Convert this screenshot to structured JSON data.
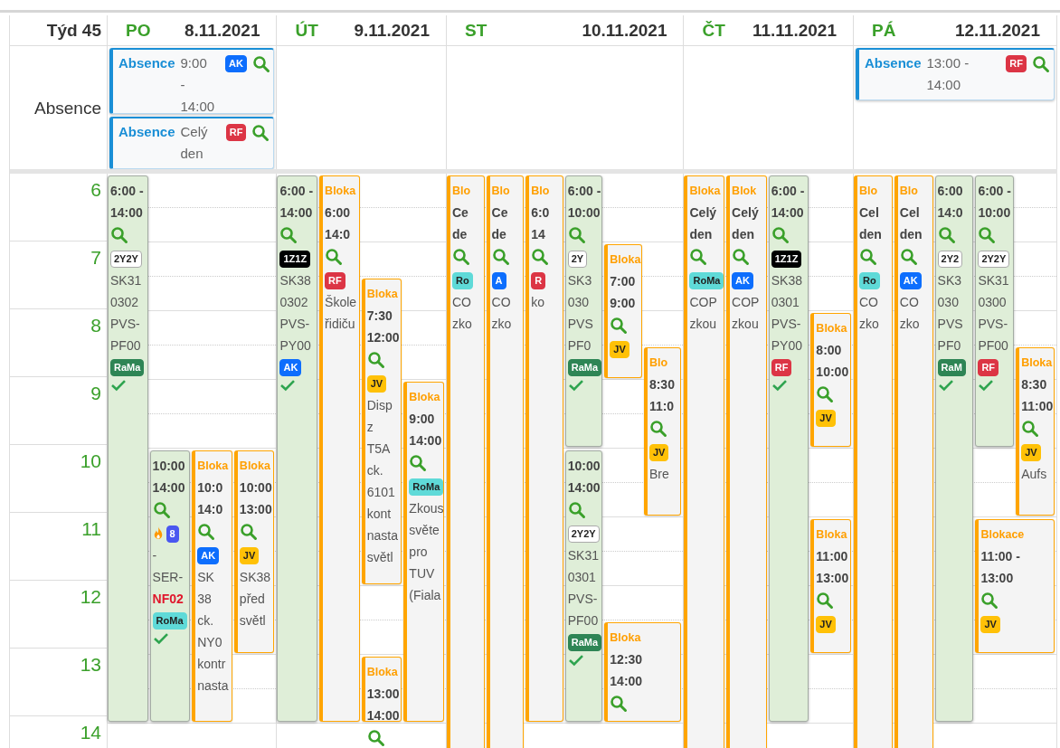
{
  "header": {
    "week": "Týd 45"
  },
  "absence_label": "Absence",
  "hours": [
    "6",
    "7",
    "8",
    "9",
    "10",
    "11",
    "12",
    "13",
    "14"
  ],
  "days": [
    {
      "name": "PO",
      "date": "8.11.2021",
      "absences": [
        {
          "label": "Absence",
          "time": "9:00 - 14:00",
          "badge": {
            "text": "AK",
            "color": "#0d6efd"
          }
        },
        {
          "label": "Absence",
          "time": "Celý den",
          "badge": {
            "text": "RF",
            "color": "#dc3545"
          }
        }
      ],
      "events": [
        {
          "kind": "job",
          "all_day": false,
          "time": [
            "6:00 -",
            "14:00"
          ],
          "top_badges": [
            {
              "text": "2Y2Y",
              "color": "#ffffff"
            }
          ],
          "fire": false,
          "desc": [
            "SK31",
            "0302",
            "PVS-",
            "PF00"
          ],
          "bottom_badges": [
            {
              "text": "RaMa",
              "color": "#2e8555"
            }
          ],
          "confirmed": true
        },
        {
          "kind": "job",
          "all_day": false,
          "time": [
            "10:00",
            "14:00"
          ],
          "top_badges": [
            {
              "text": "8",
              "color": "#4a57f0"
            }
          ],
          "fire": true,
          "desc": [
            "-",
            "SER-"
          ],
          "flagged": "NF02",
          "bottom_badges": [
            {
              "text": "RoMa",
              "color": "#5fdad8"
            }
          ],
          "confirmed": true
        },
        {
          "kind": "block",
          "all_day": false,
          "title": "Bloka",
          "time": [
            "10:0",
            "14:0"
          ],
          "top_badges": [
            {
              "text": "AK",
              "color": "#0d6efd"
            }
          ],
          "fire": false,
          "desc": [
            "SK",
            "38",
            "ck.",
            "NY0",
            "kontr",
            "nasta"
          ],
          "confirmed": false
        },
        {
          "kind": "block",
          "all_day": false,
          "title": "Bloka",
          "time": [
            "10:00",
            "13:00"
          ],
          "top_badges": [
            {
              "text": "JV",
              "color": "#ffc107"
            }
          ],
          "fire": false,
          "desc": [
            "SK38",
            "před",
            "světl"
          ],
          "confirmed": false
        }
      ]
    },
    {
      "name": "ÚT",
      "date": "9.11.2021",
      "events": [
        {
          "kind": "job",
          "all_day": false,
          "time": [
            "6:00 -",
            "14:00"
          ],
          "top_badges": [
            {
              "text": "1Z1Z",
              "color": "#000000"
            }
          ],
          "fire": false,
          "desc": [
            "SK38",
            "0302",
            "PVS-",
            "PY00"
          ],
          "bottom_badges": [
            {
              "text": "AK",
              "color": "#0d6efd"
            }
          ],
          "confirmed": true
        },
        {
          "kind": "block",
          "all_day": false,
          "title": "Bloka",
          "time": [
            "6:00",
            "14:0"
          ],
          "top_badges": [
            {
              "text": "RF",
              "color": "#dc3545"
            }
          ],
          "fire": false,
          "desc": [
            "Škole",
            "řidiču"
          ],
          "confirmed": false
        },
        {
          "kind": "block",
          "all_day": false,
          "title": "Bloka",
          "time": [
            "7:30",
            "12:00"
          ],
          "top_badges": [
            {
              "text": "JV",
              "color": "#ffc107"
            }
          ],
          "fire": false,
          "desc": [
            "Disp",
            "z",
            "T5A",
            "ck.",
            "6101",
            "kont",
            "nasta",
            "světl"
          ],
          "confirmed": false
        },
        {
          "kind": "block",
          "all_day": false,
          "title": "Bloka",
          "time": [
            "9:00",
            "14:00"
          ],
          "top_badges": [
            {
              "text": "RoMa",
              "color": "#5fdad8"
            }
          ],
          "fire": false,
          "desc": [
            "Zkous",
            "světe",
            "pro",
            "TUV",
            "(Fiala"
          ],
          "confirmed": false
        },
        {
          "kind": "block",
          "all_day": false,
          "title": "Bloka",
          "time": [
            "13:00",
            "14:00"
          ],
          "fire": false,
          "confirmed": false
        }
      ]
    },
    {
      "name": "ST",
      "date": "10.11.2021",
      "events": [
        {
          "kind": "block",
          "all_day": true,
          "title": "Blo",
          "time": [
            "Ce",
            "de"
          ],
          "top_badges": [
            {
              "text": "Ro",
              "color": "#5fdad8"
            }
          ],
          "fire": false,
          "desc": [
            "CO",
            "zko"
          ],
          "confirmed": false
        },
        {
          "kind": "block",
          "all_day": true,
          "title": "Blo",
          "time": [
            "Ce",
            "de"
          ],
          "top_badges": [
            {
              "text": "A",
              "color": "#0d6efd"
            }
          ],
          "fire": false,
          "desc": [
            "CO",
            "zko"
          ],
          "confirmed": false
        },
        {
          "kind": "block",
          "all_day": false,
          "title": "Blo",
          "time": [
            "6:0",
            "14"
          ],
          "top_badges": [
            {
              "text": "R",
              "color": "#dc3545"
            }
          ],
          "fire": false,
          "desc": [
            "ko"
          ],
          "confirmed": false
        },
        {
          "kind": "job",
          "all_day": false,
          "time": [
            "6:00 -",
            "10:00"
          ],
          "top_badges": [
            {
              "text": "2Y",
              "color": "#ffffff"
            }
          ],
          "fire": false,
          "desc": [
            "SK3",
            "030",
            "PVS",
            "PF0"
          ],
          "bottom_badges": [
            {
              "text": "RaMa",
              "color": "#2e8555"
            }
          ],
          "confirmed": true
        },
        {
          "kind": "block",
          "all_day": false,
          "title": "Bloka",
          "time": [
            "7:00",
            "9:00"
          ],
          "top_badges": [
            {
              "text": "JV",
              "color": "#ffc107"
            }
          ],
          "fire": false,
          "confirmed": false
        },
        {
          "kind": "block",
          "all_day": false,
          "title": "Blo",
          "time": [
            "8:30",
            "11:0"
          ],
          "top_badges": [
            {
              "text": "JV",
              "color": "#ffc107"
            }
          ],
          "fire": false,
          "desc": [
            "Bre"
          ],
          "confirmed": false
        },
        {
          "kind": "job",
          "all_day": false,
          "time": [
            "10:00",
            "14:00"
          ],
          "top_badges": [
            {
              "text": "2Y2Y",
              "color": "#ffffff"
            }
          ],
          "fire": false,
          "desc": [
            "SK31",
            "0301",
            "PVS-",
            "PF00"
          ],
          "bottom_badges": [
            {
              "text": "RaMa",
              "color": "#2e8555"
            }
          ],
          "confirmed": true
        },
        {
          "kind": "block",
          "all_day": false,
          "title": "Bloka",
          "time": [
            "12:30",
            "14:00"
          ],
          "fire": false,
          "confirmed": false
        }
      ]
    },
    {
      "name": "ČT",
      "date": "11.11.2021",
      "events": [
        {
          "kind": "block",
          "all_day": true,
          "title": "Bloka",
          "time": [
            "Celý",
            "den"
          ],
          "top_badges": [
            {
              "text": "RoMa",
              "color": "#5fdad8"
            }
          ],
          "fire": false,
          "desc": [
            "COP",
            "zkou"
          ],
          "confirmed": false
        },
        {
          "kind": "block",
          "all_day": true,
          "title": "Blok",
          "time": [
            "Celý",
            "den"
          ],
          "top_badges": [
            {
              "text": "AK",
              "color": "#0d6efd"
            }
          ],
          "fire": false,
          "desc": [
            "COP",
            "zkou"
          ],
          "confirmed": false
        },
        {
          "kind": "job",
          "all_day": false,
          "time": [
            "6:00 -",
            "14:00"
          ],
          "top_badges": [
            {
              "text": "1Z1Z",
              "color": "#000000"
            }
          ],
          "fire": false,
          "desc": [
            "SK38",
            "0301",
            "PVS-",
            "PY00"
          ],
          "bottom_badges": [
            {
              "text": "RF",
              "color": "#dc3545"
            }
          ],
          "confirmed": true
        },
        {
          "kind": "block",
          "all_day": false,
          "title": "Bloka",
          "time": [
            "8:00",
            "10:00"
          ],
          "top_badges": [
            {
              "text": "JV",
              "color": "#ffc107"
            }
          ],
          "fire": false,
          "confirmed": false
        },
        {
          "kind": "block",
          "all_day": false,
          "title": "Bloka",
          "time": [
            "11:00",
            "13:00"
          ],
          "top_badges": [
            {
              "text": "JV",
              "color": "#ffc107"
            }
          ],
          "fire": false,
          "confirmed": false
        }
      ]
    },
    {
      "name": "PÁ",
      "date": "12.11.2021",
      "absences": [
        {
          "label": "Absence",
          "time": "13:00 - 14:00",
          "badge": {
            "text": "RF",
            "color": "#dc3545"
          }
        }
      ],
      "events": [
        {
          "kind": "block",
          "all_day": true,
          "title": "Blo",
          "time": [
            "Cel",
            "den"
          ],
          "top_badges": [
            {
              "text": "Ro",
              "color": "#5fdad8"
            }
          ],
          "fire": false,
          "desc": [
            "CO",
            "zko"
          ],
          "confirmed": false
        },
        {
          "kind": "block",
          "all_day": true,
          "title": "Blo",
          "time": [
            "Cel",
            "den"
          ],
          "top_badges": [
            {
              "text": "AK",
              "color": "#0d6efd"
            }
          ],
          "fire": false,
          "desc": [
            "CO",
            "zko"
          ],
          "confirmed": false
        },
        {
          "kind": "job",
          "all_day": false,
          "time": [
            "6:00",
            "14:0"
          ],
          "top_badges": [
            {
              "text": "2Y2",
              "color": "#ffffff"
            }
          ],
          "fire": false,
          "desc": [
            "SK3",
            "030",
            "PVS",
            "PF0"
          ],
          "bottom_badges": [
            {
              "text": "RaM",
              "color": "#2e8555"
            }
          ],
          "confirmed": true
        },
        {
          "kind": "job",
          "all_day": false,
          "time": [
            "6:00 -",
            "10:00"
          ],
          "top_badges": [
            {
              "text": "2Y2Y",
              "color": "#ffffff"
            }
          ],
          "fire": false,
          "desc": [
            "SK31",
            "0300",
            "PVS-",
            "PF00"
          ],
          "bottom_badges": [
            {
              "text": "RF",
              "color": "#dc3545"
            }
          ],
          "confirmed": true
        },
        {
          "kind": "block",
          "all_day": false,
          "title": "Bloka",
          "time": [
            "8:30",
            "11:00"
          ],
          "top_badges": [
            {
              "text": "JV",
              "color": "#ffc107"
            }
          ],
          "fire": false,
          "desc": [
            "Aufs"
          ],
          "confirmed": false
        },
        {
          "kind": "block",
          "all_day": false,
          "title": "Blokace",
          "time": [
            "11:00 -",
            "13:00"
          ],
          "top_badges": [
            {
              "text": "JV",
              "color": "#ffc107"
            }
          ],
          "fire": false,
          "confirmed": false
        }
      ]
    }
  ]
}
